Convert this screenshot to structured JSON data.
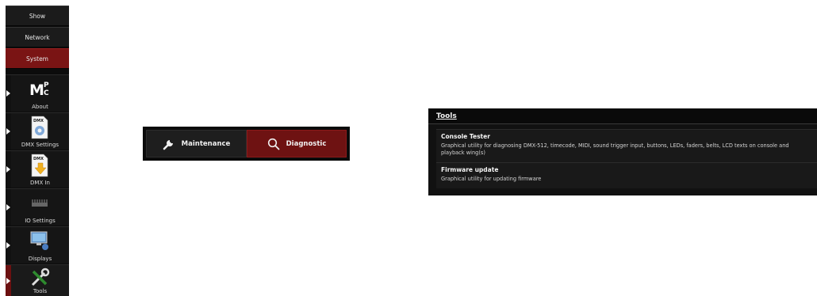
{
  "sidebar": {
    "tabs": [
      {
        "label": "Show"
      },
      {
        "label": "Network"
      },
      {
        "label": "System"
      }
    ],
    "items": [
      {
        "label": "About",
        "icon": "mpc-logo-icon"
      },
      {
        "label": "DMX Settings",
        "icon": "dmx-settings-icon"
      },
      {
        "label": "DMX In",
        "icon": "dmx-in-icon"
      },
      {
        "label": "IO Settings",
        "icon": "chip-icon"
      },
      {
        "label": "Displays",
        "icon": "displays-icon"
      },
      {
        "label": "Tools",
        "icon": "tools-icon"
      }
    ]
  },
  "modebar": {
    "maintenance": "Maintenance",
    "diagnostic": "Diagnostic"
  },
  "tools_panel": {
    "title": "Tools",
    "rows": [
      {
        "title": "Console Tester",
        "desc": "Graphical utility for diagnosing DMX-512, timecode, MIDI, sound trigger input, buttons, LEDs, faders, belts, LCD texts on console and playback wing(s)"
      },
      {
        "title": "Firmware update",
        "desc": "Graphical utility for updating firmware"
      }
    ]
  },
  "colors": {
    "accent": "#7a1414",
    "panel": "#111111"
  }
}
